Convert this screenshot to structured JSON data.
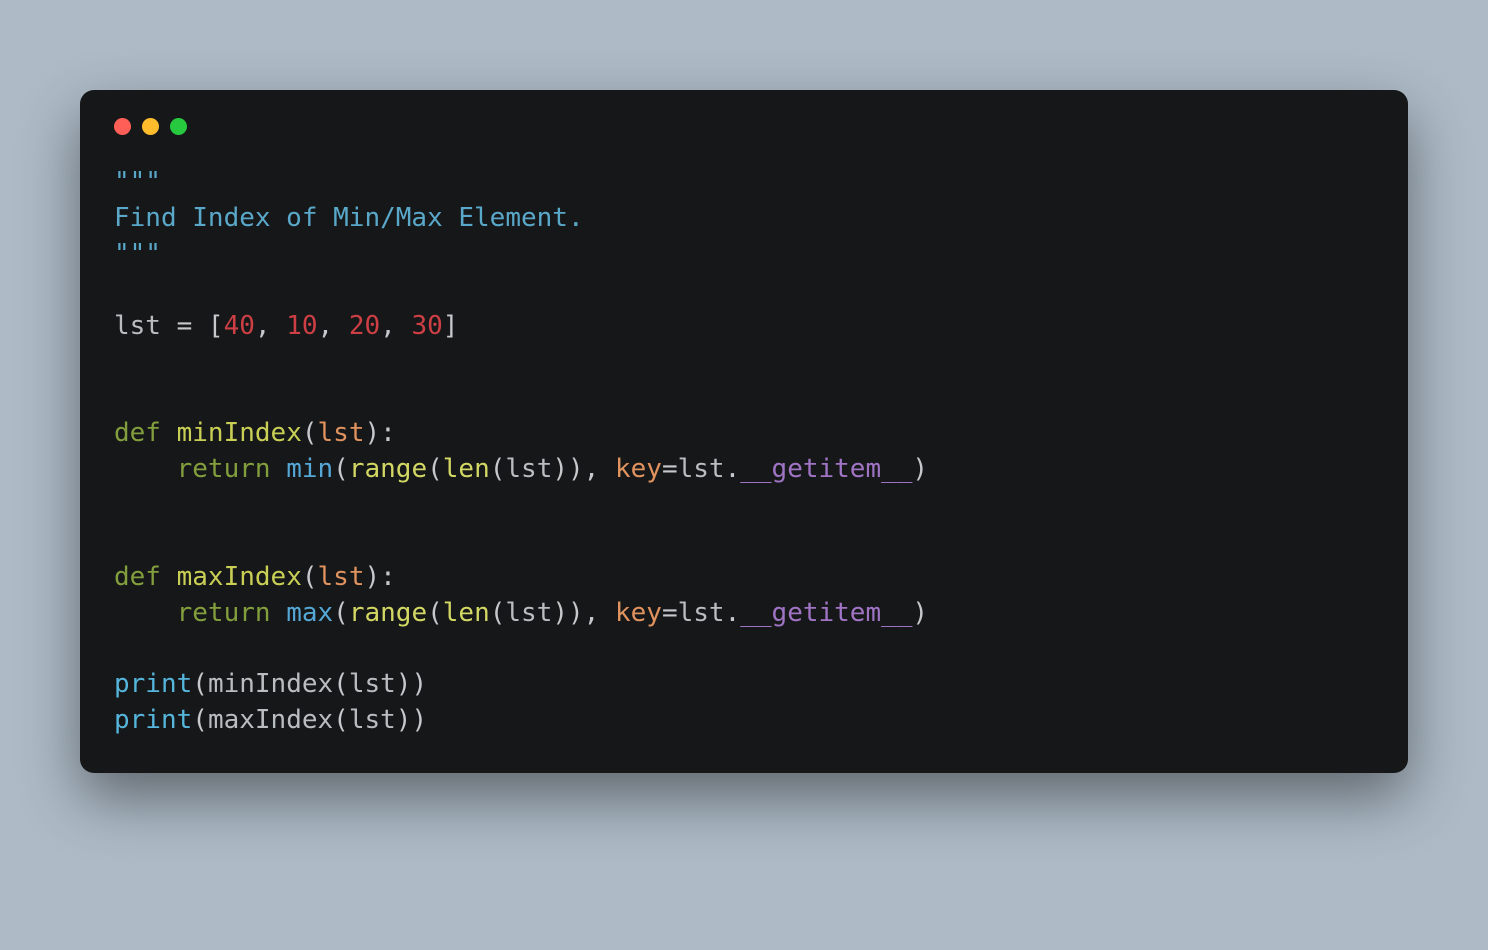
{
  "traffic_lights": {
    "red": "#ff5f56",
    "yellow": "#ffbd2e",
    "green": "#27c93f"
  },
  "code": {
    "l01_a": "\"\"\"",
    "l02_a": "Find Index of Min/Max Element.",
    "l03_a": "\"\"\"",
    "l04_blank": "",
    "l05_var": "lst",
    "l05_eq": " = [",
    "l05_n1": "40",
    "l05_c1": ", ",
    "l05_n2": "10",
    "l05_c2": ", ",
    "l05_n3": "20",
    "l05_c3": ", ",
    "l05_n4": "30",
    "l05_close": "]",
    "l06_blank": "",
    "l07_blank": "",
    "l08_def": "def",
    "l08_sp": " ",
    "l08_fn": "minIndex",
    "l08_pre": "(",
    "l08_arg": "lst",
    "l08_post": "):",
    "l09_indent": "    ",
    "l09_ret": "return",
    "l09_sp1": " ",
    "l09_min": "min",
    "l09_p1": "(",
    "l09_range": "range",
    "l09_p2": "(",
    "l09_len": "len",
    "l09_p3": "(",
    "l09_lst": "lst",
    "l09_p4": ")), ",
    "l09_key": "key",
    "l09_eq": "=",
    "l09_lst2": "lst",
    "l09_dot": ".",
    "l09_dunder": "__getitem__",
    "l09_p5": ")",
    "l10_blank": "",
    "l11_blank": "",
    "l12_def": "def",
    "l12_sp": " ",
    "l12_fn": "maxIndex",
    "l12_pre": "(",
    "l12_arg": "lst",
    "l12_post": "):",
    "l13_indent": "    ",
    "l13_ret": "return",
    "l13_sp1": " ",
    "l13_max": "max",
    "l13_p1": "(",
    "l13_range": "range",
    "l13_p2": "(",
    "l13_len": "len",
    "l13_p3": "(",
    "l13_lst": "lst",
    "l13_p4": ")), ",
    "l13_key": "key",
    "l13_eq": "=",
    "l13_lst2": "lst",
    "l13_dot": ".",
    "l13_dunder": "__getitem__",
    "l13_p5": ")",
    "l14_blank": "",
    "l15_print": "print",
    "l15_p1": "(",
    "l15_fn": "minIndex",
    "l15_p2": "(",
    "l15_arg": "lst",
    "l15_p3": "))",
    "l16_print": "print",
    "l16_p1": "(",
    "l16_fn": "maxIndex",
    "l16_p2": "(",
    "l16_arg": "lst",
    "l16_p3": "))"
  }
}
